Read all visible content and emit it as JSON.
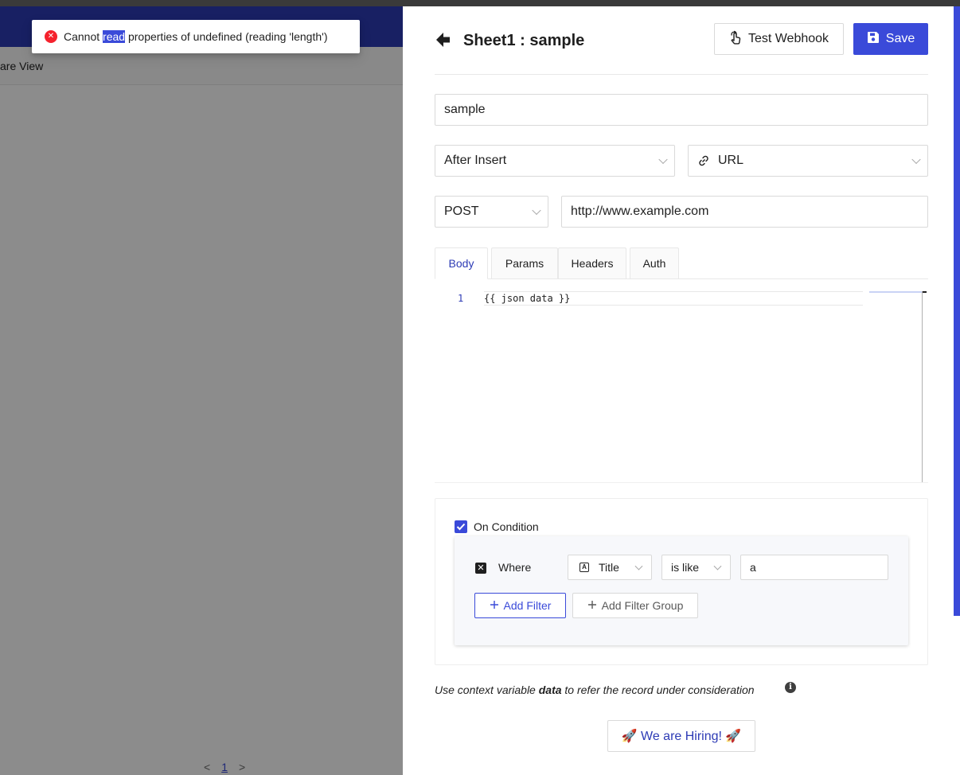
{
  "toast": {
    "icon": "error-circle-icon",
    "text_before": "Cannot ",
    "text_selected": "read",
    "text_after": " properties of undefined (reading 'length')"
  },
  "background": {
    "toolbar_text": "are View",
    "pagination": {
      "prev": "<",
      "page": "1",
      "next": ">"
    }
  },
  "drawer": {
    "title": "Sheet1 : sample",
    "test_button": "Test Webhook",
    "save_button": "Save",
    "name_value": "sample",
    "event_value": "After Insert",
    "type_value": "URL",
    "method_value": "POST",
    "url_value": "http://www.example.com",
    "tabs": [
      {
        "label": "Body",
        "active": true
      },
      {
        "label": "Params",
        "active": false
      },
      {
        "label": "Headers",
        "active": false
      },
      {
        "label": "Auth",
        "active": false
      }
    ],
    "editor": {
      "line_number": "1",
      "line_text": "{{ json data }}"
    },
    "condition": {
      "checked": true,
      "label": "On Condition",
      "where_label": "Where",
      "field_value": "Title",
      "operator_value": "is like",
      "filter_value": "a",
      "add_filter": "Add Filter",
      "add_filter_group": "Add Filter Group"
    },
    "hint": {
      "before": "Use context variable ",
      "bold": "data",
      "after": " to refer the record under consideration"
    },
    "hiring_button": "🚀 We are Hiring! 🚀"
  },
  "colors": {
    "accent": "#3a4ad9",
    "header": "#2d3bb5",
    "error": "#f5222d"
  }
}
